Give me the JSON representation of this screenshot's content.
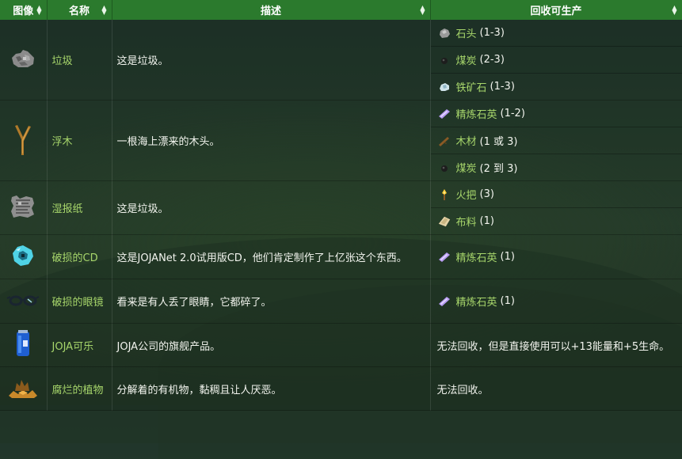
{
  "headers": {
    "image": "图像",
    "name": "名称",
    "description": "描述",
    "recycle": "回收可生产"
  },
  "rows": [
    {
      "icon": "trash-icon",
      "name": "垃圾",
      "description": "这是垃圾。",
      "recycle": [
        {
          "icon": "stone-icon",
          "item": "石头",
          "qty": "(1-3)"
        },
        {
          "icon": "coal-icon",
          "item": "煤炭",
          "qty": "(2-3)"
        },
        {
          "icon": "iron-ore-icon",
          "item": "铁矿石",
          "qty": "(1-3)"
        }
      ]
    },
    {
      "icon": "driftwood-icon",
      "name": "浮木",
      "description": "一根海上漂来的木头。",
      "recycle": [
        {
          "icon": "refined-quartz-icon",
          "item": "精炼石英",
          "qty": "(1-2)"
        },
        {
          "icon": "wood-icon",
          "item": "木材",
          "qty": "(1 或 3)"
        },
        {
          "icon": "coal-icon",
          "item": "煤炭",
          "qty": "(2 到 3)"
        }
      ]
    },
    {
      "icon": "soggy-newspaper-icon",
      "name": "湿报纸",
      "description": "这是垃圾。",
      "recycle": [
        {
          "icon": "torch-icon",
          "item": "火把",
          "qty": "(3)"
        },
        {
          "icon": "cloth-icon",
          "item": "布料",
          "qty": "(1)"
        }
      ]
    },
    {
      "icon": "broken-cd-icon",
      "name": "破损的CD",
      "description": "这是JOJANet 2.0试用版CD，他们肯定制作了上亿张这个东西。",
      "recycle": [
        {
          "icon": "refined-quartz-icon",
          "item": "精炼石英",
          "qty": "(1)"
        }
      ]
    },
    {
      "icon": "broken-glasses-icon",
      "name": "破损的眼镜",
      "description": "看来是有人丢了眼睛，它都碎了。",
      "recycle": [
        {
          "icon": "refined-quartz-icon",
          "item": "精炼石英",
          "qty": "(1)"
        }
      ]
    },
    {
      "icon": "joja-cola-icon",
      "name": "JOJA可乐",
      "description": "JOJA公司的旗舰产品。",
      "recycle_text": "无法回收，但是直接使用可以+13能量和+5生命。"
    },
    {
      "icon": "rotten-plant-icon",
      "name": "腐烂的植物",
      "description": "分解着的有机物，黏稠且让人厌恶。",
      "recycle_text": "无法回收。"
    }
  ]
}
